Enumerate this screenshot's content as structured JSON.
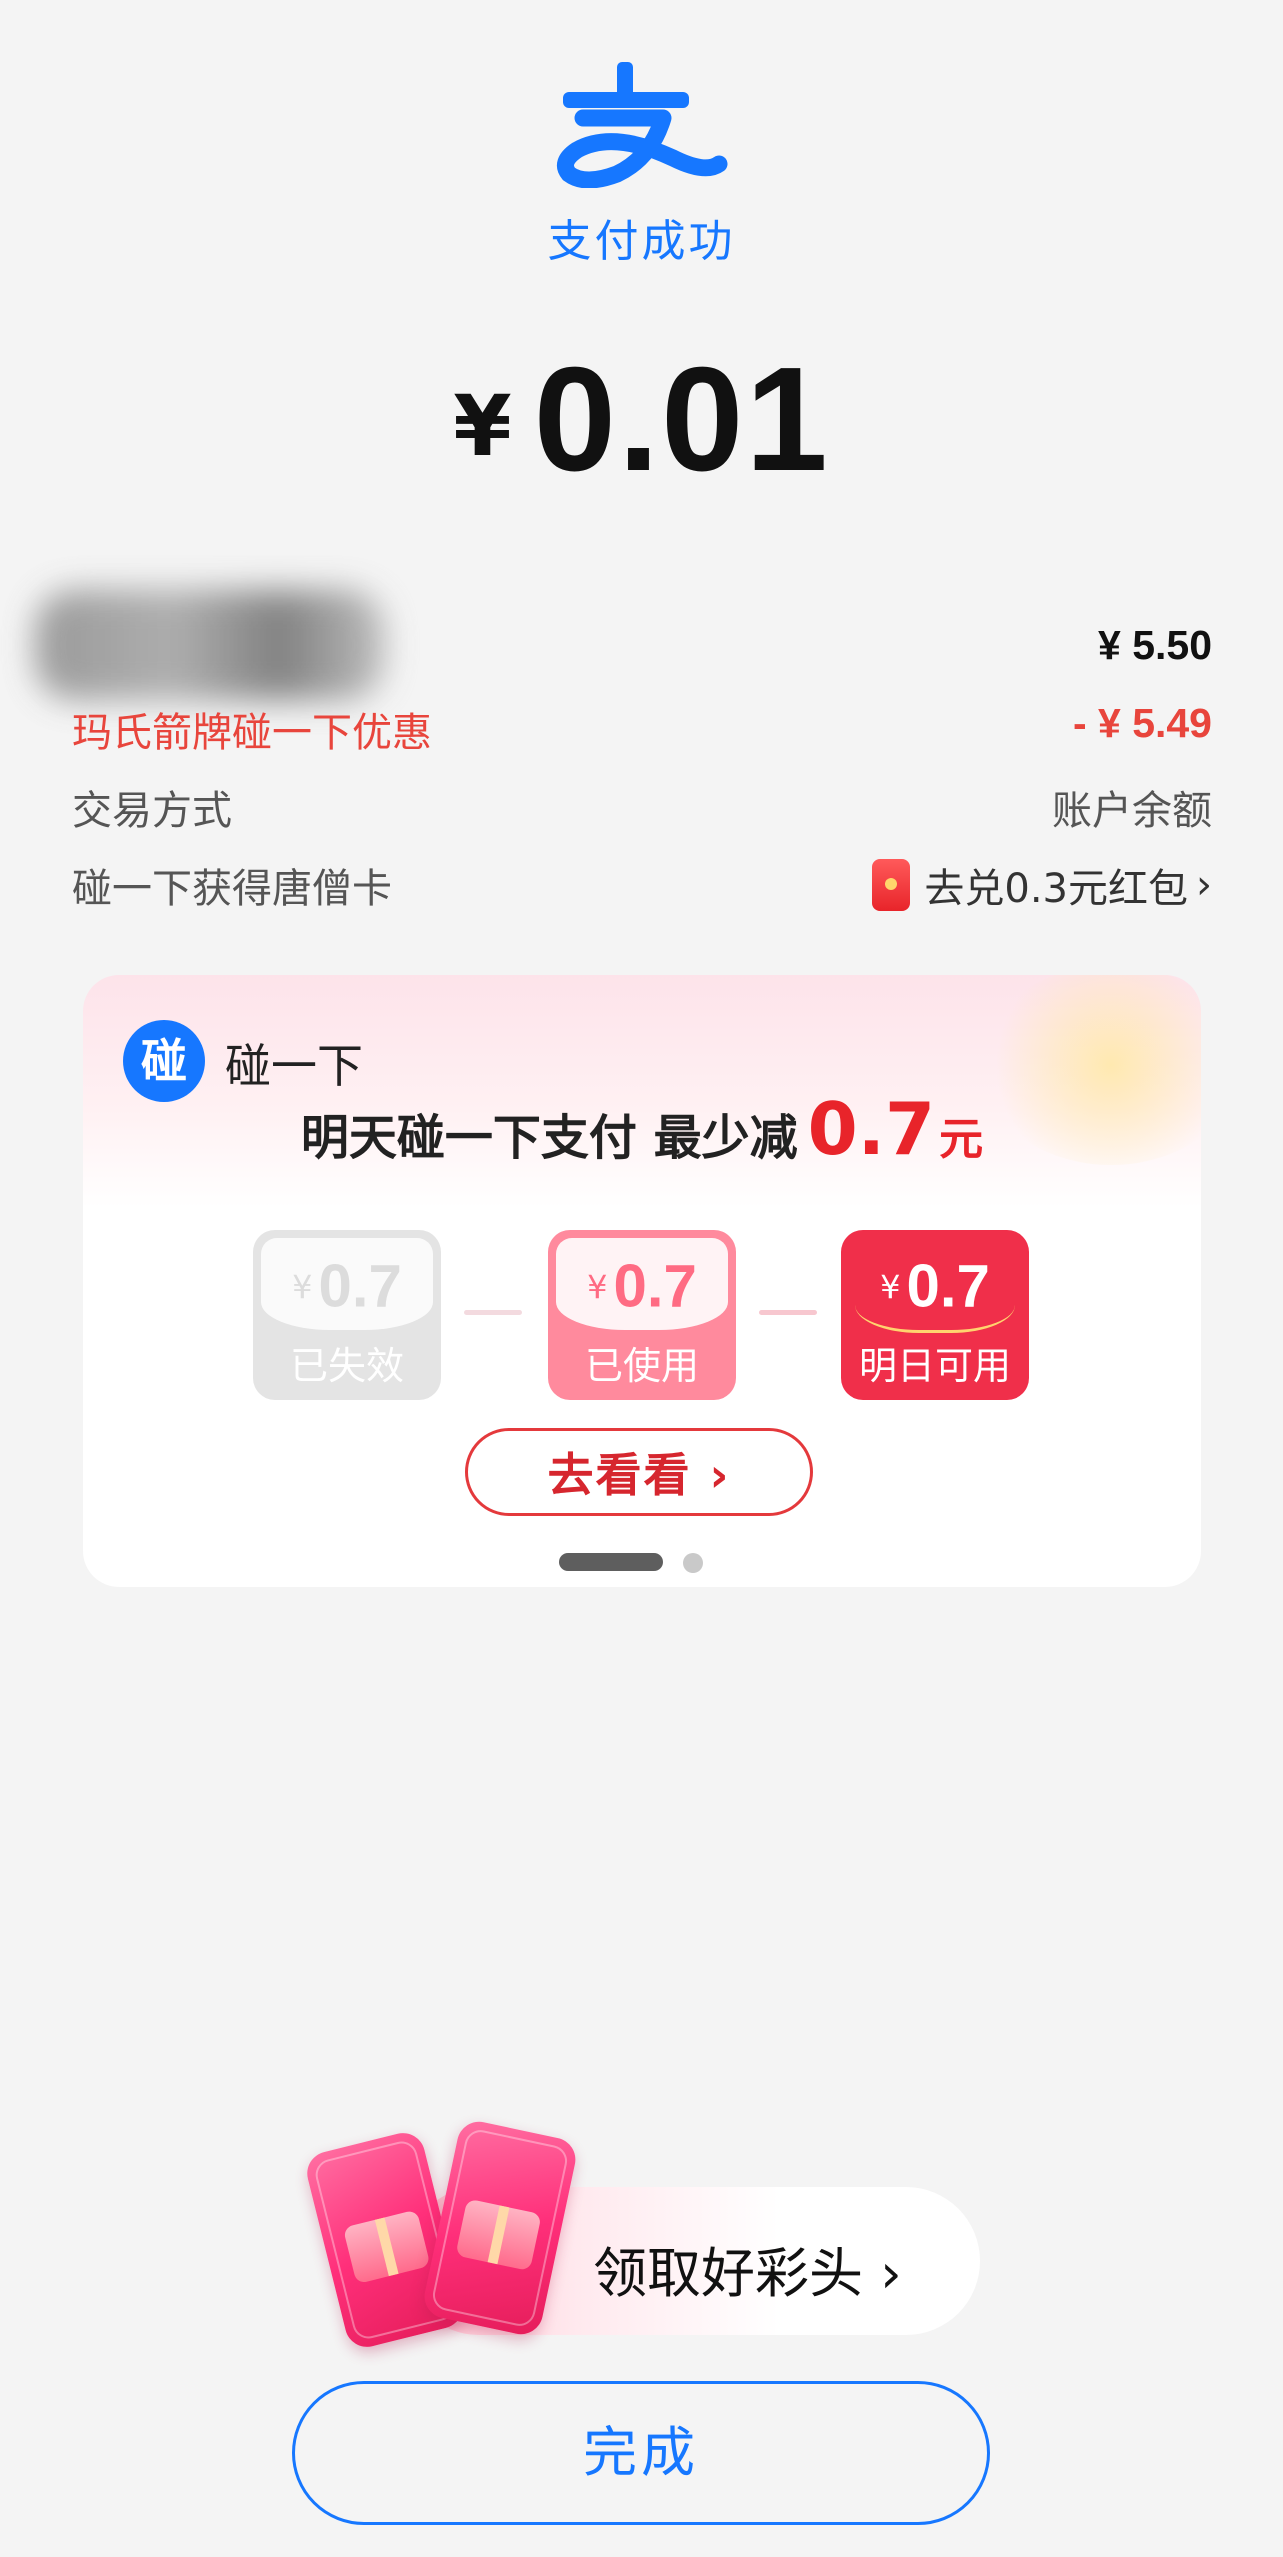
{
  "status": {
    "label": "支付成功",
    "icon": "alipay-logo-icon",
    "brand_color": "#1677ff"
  },
  "amount": {
    "currency": "¥",
    "value": "0.01"
  },
  "rows": {
    "price": {
      "value": "¥ 5.50"
    },
    "discount": {
      "label": "玛氏箭牌碰一下优惠",
      "value": "- ¥ 5.49"
    },
    "method": {
      "label": "交易方式",
      "value": "账户余额"
    },
    "card": {
      "label": "碰一下获得唐僧卡",
      "value": "去兑0.3元红包",
      "icon": "red-packet-icon"
    }
  },
  "promo": {
    "brand": "碰一下",
    "brand_badge": "碰",
    "headline_text": "明天碰一下支付 最少减",
    "headline_value": "0.7",
    "headline_unit": "元",
    "coupons": [
      {
        "currency": "¥",
        "value": "0.7",
        "label": "已失效"
      },
      {
        "currency": "¥",
        "value": "0.7",
        "label": "已使用"
      },
      {
        "currency": "¥",
        "value": "0.7",
        "label": "明日可用"
      }
    ],
    "cta": "去看看 ›",
    "carousel": {
      "pages": 2,
      "active": 1
    }
  },
  "lucky": {
    "label": "领取好彩头 ›"
  },
  "done": {
    "label": "完成"
  }
}
